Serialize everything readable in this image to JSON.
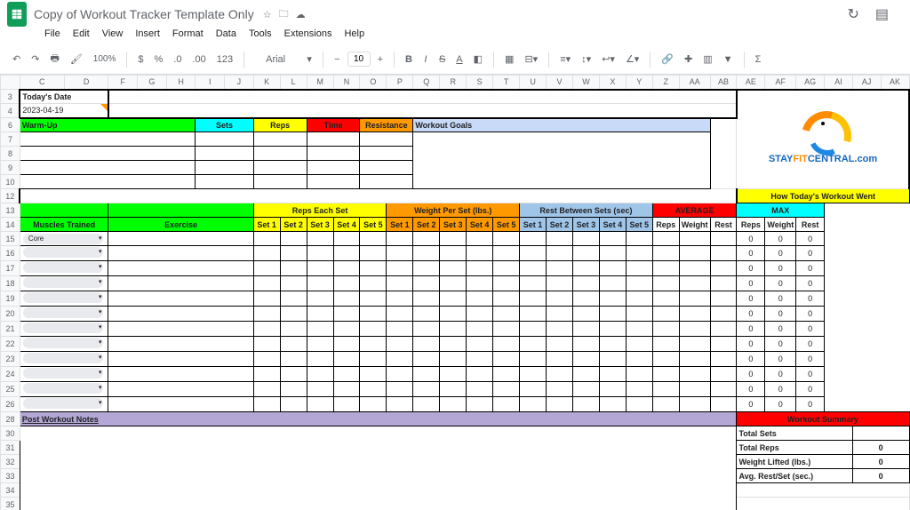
{
  "doc": {
    "title": "Copy of Workout Tracker Template Only"
  },
  "menus": [
    "File",
    "Edit",
    "View",
    "Insert",
    "Format",
    "Data",
    "Tools",
    "Extensions",
    "Help"
  ],
  "toolbar": {
    "zoom": "100%",
    "font": "Arial",
    "fontSize": "10"
  },
  "cols": [
    "C",
    "D",
    "F",
    "G",
    "H",
    "I",
    "J",
    "K",
    "L",
    "M",
    "N",
    "O",
    "P",
    "Q",
    "R",
    "S",
    "T",
    "U",
    "V",
    "W",
    "X",
    "Y",
    "Z",
    "AA",
    "AB",
    "AE",
    "AF",
    "AG",
    "AI",
    "AJ",
    "AK"
  ],
  "rows": [
    "3",
    "4",
    "6",
    "7",
    "8",
    "9",
    "10",
    "12",
    "13",
    "14",
    "15",
    "16",
    "17",
    "18",
    "19",
    "20",
    "21",
    "22",
    "23",
    "24",
    "25",
    "26",
    "28",
    "30",
    "31",
    "32",
    "33",
    "34",
    "35"
  ],
  "header": {
    "todays_date_label": "Today's Date",
    "todays_date_value": "2023-04-19",
    "warmup": "Warm-Up",
    "sets": "Sets",
    "reps": "Reps",
    "time": "Time",
    "resistance": "Resistance",
    "workout_goals": "Workout Goals",
    "muscles_trained": "Muscles Trained",
    "exercise": "Exercise",
    "reps_each_set": "Reps Each Set",
    "weight_per_set": "Weight Per Set (lbs.)",
    "rest_between": "Rest Between Sets (sec)",
    "average": "AVERAGE",
    "max": "MAX",
    "how_today": "How Today's Workout Went",
    "set_labels": [
      "Set 1",
      "Set 2",
      "Set 3",
      "Set 4",
      "Set 5"
    ],
    "avg_cols": [
      "Reps",
      "Weight",
      "Rest"
    ],
    "max_cols": [
      "Reps",
      "Weight",
      "Rest"
    ],
    "post_workout": "Post Workout Notes",
    "workout_summary": "Workout Summary",
    "total_sets": "Total Sets",
    "total_reps": "Total Reps",
    "weight_lifted": "Weight Lifted (lbs.)",
    "avg_rest": "Avg. Rest/Set (sec.)"
  },
  "dropdowns": [
    "Core",
    "",
    "",
    "",
    "",
    "",
    "",
    "",
    "",
    "",
    "",
    ""
  ],
  "max_vals": {
    "reps": "0",
    "weight": "0",
    "rest": "0"
  },
  "summary_vals": {
    "total_reps": "0",
    "weight_lifted": "0",
    "avg_rest": "0"
  },
  "logo": {
    "text1": "STAY",
    "text2": "FIT",
    "text3": "CENTRAL",
    "text4": ".com"
  }
}
